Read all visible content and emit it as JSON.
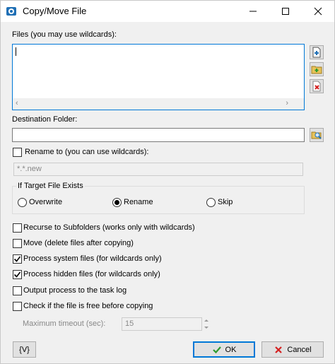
{
  "window": {
    "title": "Copy/Move File"
  },
  "files": {
    "label": "Files (you may use wildcards):",
    "value": ""
  },
  "destination": {
    "label": "Destination Folder:",
    "value": ""
  },
  "rename": {
    "label": "Rename to (you can use wildcards):",
    "checked": false,
    "value": "*.*.new"
  },
  "target_exists": {
    "label": "If Target File Exists",
    "options": [
      "Overwrite",
      "Rename",
      "Skip"
    ],
    "selected": "Rename"
  },
  "options": [
    {
      "label": "Recurse to Subfolders (works only with wildcards)",
      "checked": false
    },
    {
      "label": "Move (delete files after copying)",
      "checked": false
    },
    {
      "label": "Process system files (for wildcards only)",
      "checked": true
    },
    {
      "label": "Process hidden files (for wildcards only)",
      "checked": true
    },
    {
      "label": "Output process to the task log",
      "checked": false
    },
    {
      "label": "Check if the file is free before copying",
      "checked": false
    }
  ],
  "timeout": {
    "label": "Maximum timeout (sec):",
    "value": "15"
  },
  "buttons": {
    "variables": "{V}",
    "ok": "OK",
    "cancel": "Cancel"
  },
  "icons": {
    "app": "copy-app-icon",
    "add_file": "add-file-icon",
    "add_folder": "add-folder-icon",
    "remove": "remove-icon",
    "browse": "browse-folder-icon",
    "ok": "checkmark-icon",
    "cancel": "cross-icon"
  },
  "colors": {
    "accent": "#0078d7",
    "check_green": "#2e9a2e",
    "cancel_red": "#d42020"
  }
}
